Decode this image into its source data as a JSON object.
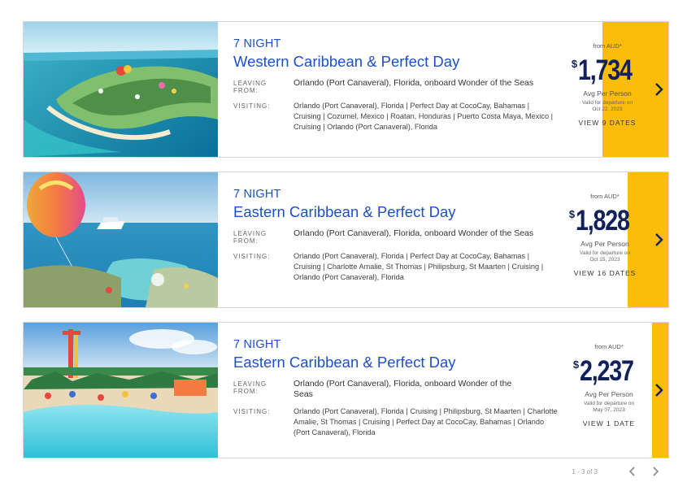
{
  "cruises": [
    {
      "nights": "7 NIGHT",
      "title": "Western Caribbean & Perfect Day",
      "leaving_label": "LEAVING FROM:",
      "leaving": "Orlando (Port Canaveral), Florida, onboard Wonder of the Seas",
      "visiting_label": "VISITING:",
      "visiting": "Orlando (Port Canaveral), Florida  |  Perfect Day at CocoCay, Bahamas  |  Cruising  |  Cozumel, Mexico  |  Roatan, Honduras  |  Puerto Costa Maya, Mexico  |  Cruising  |  Orlando (Port Canaveral), Florida",
      "from_label": "from AUD*",
      "currency": "$",
      "price": "1,734",
      "avg": "Avg Per Person",
      "valid_line1": "Valid for departure on",
      "valid_line2": "Oct 22, 2023",
      "dates_button": "VIEW 9 DATES",
      "image_alt": "aerial-island-beach"
    },
    {
      "nights": "7 NIGHT",
      "title": "Eastern Caribbean & Perfect Day",
      "leaving_label": "LEAVING FROM:",
      "leaving": "Orlando (Port Canaveral), Florida, onboard Wonder of the Seas",
      "visiting_label": "VISITING:",
      "visiting": "Orlando (Port Canaveral), Florida  |  Perfect Day at CocoCay, Bahamas  |  Cruising  |  Charlotte Amalie, St Thomas  |  Philipsburg, St Maarten  |  Cruising  |  Orlando (Port Canaveral), Florida",
      "from_label": "from AUD*",
      "currency": "$",
      "price": "1,828",
      "avg": "Avg Per Person",
      "valid_line1": "Valid for departure on",
      "valid_line2": "Oct 15, 2023",
      "dates_button": "VIEW 16 DATES",
      "image_alt": "balloon-and-ship"
    },
    {
      "nights": "7 NIGHT",
      "title": "Eastern Caribbean & Perfect Day",
      "leaving_label": "LEAVING FROM:",
      "leaving": "Orlando (Port Canaveral), Florida, onboard Wonder of the Seas",
      "visiting_label": "VISITING:",
      "visiting": "Orlando (Port Canaveral), Florida  |  Cruising  |  Philipsburg, St Maarten  |  Charlotte Amalie, St Thomas  |  Cruising  |  Perfect Day at CocoCay, Bahamas  |  Orlando (Port Canaveral), Florida",
      "from_label": "from AUD*",
      "currency": "$",
      "price": "2,237",
      "avg": "Avg Per Person",
      "valid_line1": "Valid for departure on",
      "valid_line2": "May 07, 2023",
      "dates_button": "VIEW 1 DATE",
      "image_alt": "waterpark-pool"
    }
  ],
  "pager": {
    "text": "1 - 3 of 3"
  },
  "colors": {
    "accent": "#fbbd0a",
    "title": "#1d4fc9",
    "price": "#13215a"
  },
  "icons": {
    "next_card": "chevron-right-icon",
    "prev_page": "chevron-left-icon",
    "next_page": "chevron-right-icon"
  }
}
